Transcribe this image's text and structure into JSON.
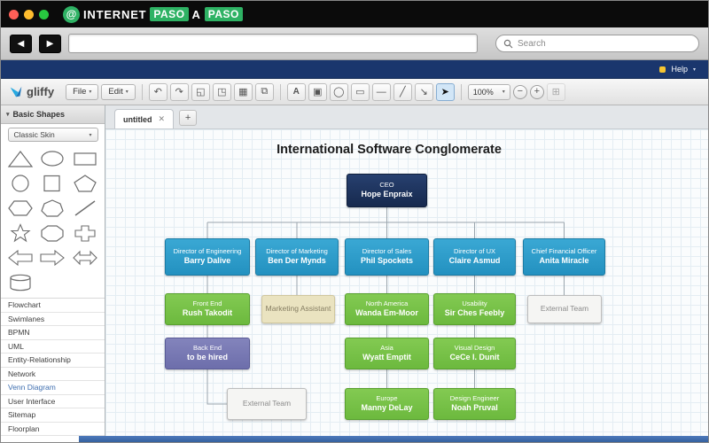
{
  "titlebar": {
    "brand": {
      "internet": "INTERNET",
      "paso1": "PASO",
      "a": "A",
      "paso2": "PASO",
      "icon_glyph": "@"
    }
  },
  "navbar": {
    "back_glyph": "◀",
    "forward_glyph": "▶",
    "url_value": "",
    "search_placeholder": "Search"
  },
  "menustrip": {
    "help_label": "Help"
  },
  "toolbar": {
    "logo_text": "gliffy",
    "file_label": "File",
    "edit_label": "Edit",
    "zoom_value": "100%",
    "icons": {
      "undo": "↶",
      "redo": "↷",
      "fit": "◱",
      "fullscreen": "◳",
      "grid": "▦",
      "duplicate": "⧉",
      "text": "A",
      "fill": "▣",
      "shape": "◯",
      "rect": "▭",
      "line_style": "—",
      "line": "╱",
      "connector": "↘",
      "pointer": "➤",
      "zoom_out": "−",
      "zoom_in": "+",
      "fit_page": "⊞"
    }
  },
  "sidebar": {
    "title": "Basic Shapes",
    "skin_label": "Classic Skin",
    "categories": [
      {
        "label": "Flowchart"
      },
      {
        "label": "Swimlanes"
      },
      {
        "label": "BPMN"
      },
      {
        "label": "UML"
      },
      {
        "label": "Entity-Relationship"
      },
      {
        "label": "Network"
      },
      {
        "label": "Venn Diagram"
      },
      {
        "label": "User Interface"
      },
      {
        "label": "Sitemap"
      },
      {
        "label": "Floorplan"
      }
    ]
  },
  "editor": {
    "tab_label": "untitled",
    "orgchart": {
      "title": "International Software Conglomerate",
      "nodes": [
        {
          "role": "CEO",
          "name": "Hope Enpraix",
          "parent": null
        },
        {
          "role": "Director of Engineering",
          "name": "Barry Dalive",
          "parent": "Hope Enpraix"
        },
        {
          "role": "Director of Marketing",
          "name": "Ben Der Mynds",
          "parent": "Hope Enpraix"
        },
        {
          "role": "Director of Sales",
          "name": "Phil Spockets",
          "parent": "Hope Enpraix"
        },
        {
          "role": "Director of UX",
          "name": "Claire Asmud",
          "parent": "Hope Enpraix"
        },
        {
          "role": "Chief Financial Officer",
          "name": "Anita Miracle",
          "parent": "Hope Enpraix"
        },
        {
          "role": "Front End",
          "name": "Rush Takodit",
          "parent": "Barry Dalive"
        },
        {
          "role": "",
          "name": "Marketing Assistant",
          "parent": "Ben Der Mynds"
        },
        {
          "role": "North America",
          "name": "Wanda Em-Moor",
          "parent": "Phil Spockets"
        },
        {
          "role": "Usability",
          "name": "Sir Ches Feebly",
          "parent": "Claire Asmud"
        },
        {
          "role": "",
          "name": "External Team",
          "parent": "Anita Miracle"
        },
        {
          "role": "Back End",
          "name": "to be hired",
          "parent": "Barry Dalive"
        },
        {
          "role": "Asia",
          "name": "Wyatt Emptit",
          "parent": "Phil Spockets"
        },
        {
          "role": "Visual Design",
          "name": "CeCe I. Dunit",
          "parent": "Claire Asmud"
        },
        {
          "role": "",
          "name": "External Team",
          "parent": "Back End"
        },
        {
          "role": "Europe",
          "name": "Manny DeLay",
          "parent": "Phil Spockets"
        },
        {
          "role": "Design Engineer",
          "name": "Noah Pruval",
          "parent": "Claire Asmud"
        }
      ]
    }
  },
  "colors": {
    "brand_green": "#2eb264",
    "menustrip_navy": "#1a366d",
    "ceo_navy": "#1c3360",
    "director_blue": "#2e9cc9",
    "staff_green": "#72bf44",
    "tbd_purple": "#7576b0",
    "assistant_beige": "#eae3c0",
    "external_gray": "#f5f5f3"
  }
}
